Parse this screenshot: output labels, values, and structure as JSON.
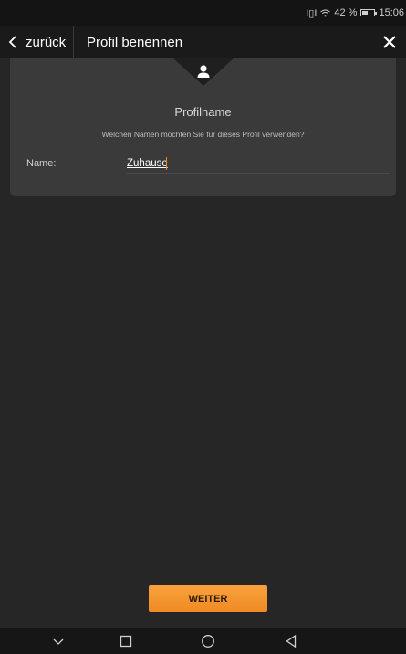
{
  "status_bar": {
    "signal_text": "I▯I",
    "wifi_icon": "wifi-icon",
    "battery_percent": "42 %",
    "time": "15:06"
  },
  "header": {
    "back_label": "zurück",
    "title": "Profil benennen"
  },
  "card": {
    "title": "Profilname",
    "question": "Welchen Namen möchten Sie für dieses Profil verwenden?",
    "name_label": "Name:",
    "name_value": "Zuhause"
  },
  "footer": {
    "next_label": "WEITER"
  },
  "colors": {
    "accent": "#f08a24",
    "background": "#262626",
    "card": "#3a3a3a"
  }
}
